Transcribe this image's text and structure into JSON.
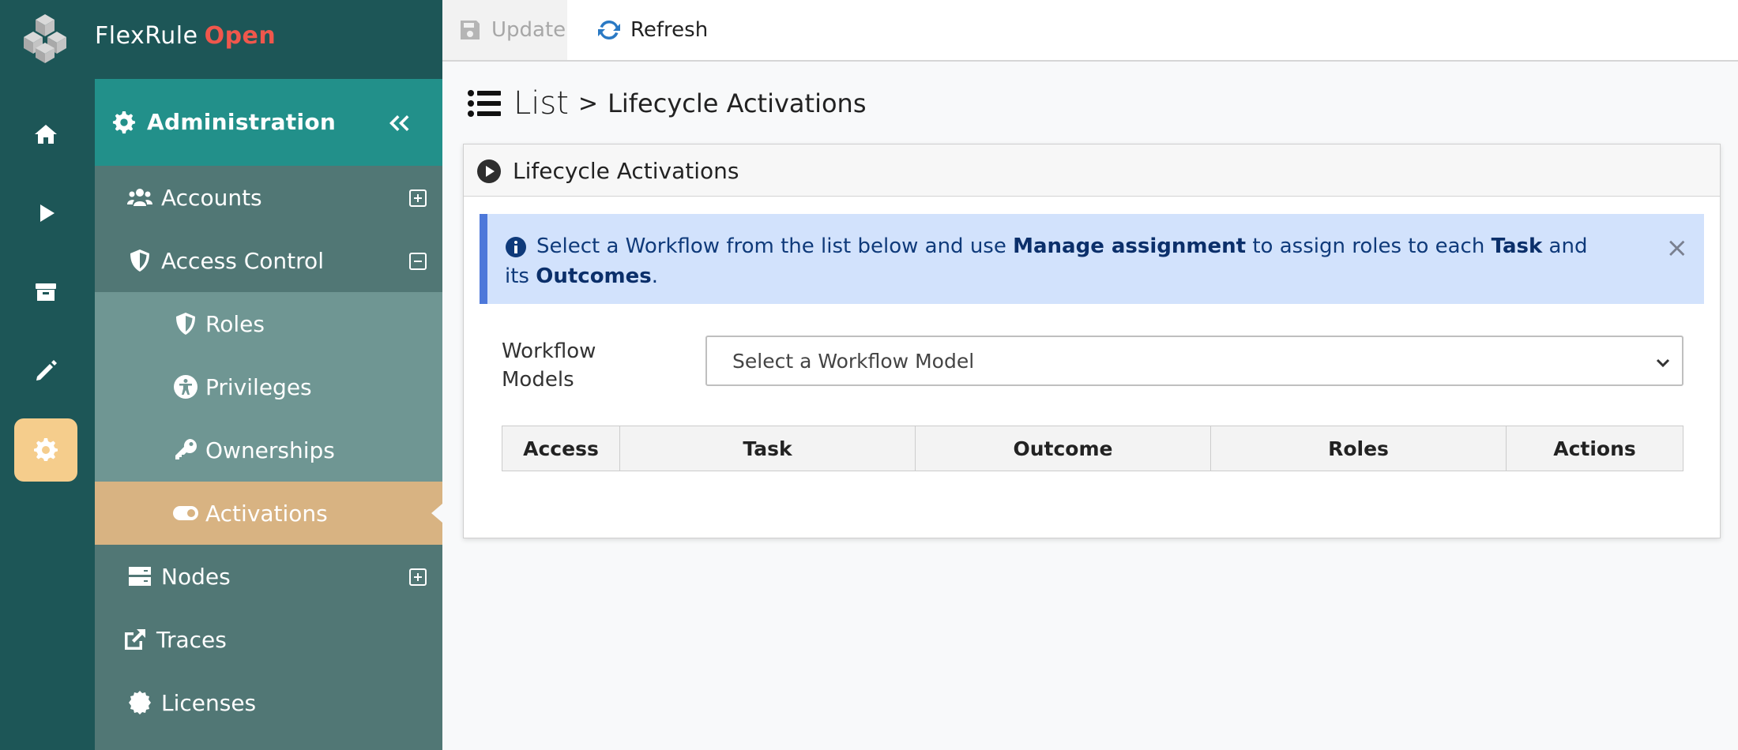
{
  "app": {
    "brand": "FlexRule",
    "brand_accent": "Open"
  },
  "rail": {
    "items": [
      {
        "icon": "home-icon"
      },
      {
        "icon": "play-icon"
      },
      {
        "icon": "archive-icon"
      },
      {
        "icon": "pencil-icon"
      },
      {
        "icon": "gear-icon",
        "active": true
      }
    ]
  },
  "sidebar": {
    "title": "Administration",
    "items": [
      {
        "label": "Accounts",
        "icon": "users-icon",
        "toggle": "expand"
      },
      {
        "label": "Access Control",
        "icon": "shield-icon",
        "toggle": "collapse"
      },
      {
        "label": "Roles",
        "icon": "shield-icon"
      },
      {
        "label": "Privileges",
        "icon": "person-icon"
      },
      {
        "label": "Ownerships",
        "icon": "key-icon"
      },
      {
        "label": "Activations",
        "icon": "toggle-icon",
        "active": true
      },
      {
        "label": "Nodes",
        "icon": "server-icon",
        "toggle": "expand"
      },
      {
        "label": "Traces",
        "icon": "external-link-icon"
      },
      {
        "label": "Licenses",
        "icon": "certificate-icon"
      }
    ]
  },
  "toolbar": {
    "update_label": "Update",
    "refresh_label": "Refresh"
  },
  "heading": {
    "list": "List",
    "separator": ">",
    "title": "Lifecycle Activations"
  },
  "card": {
    "title": "Lifecycle Activations",
    "alert": {
      "part1": "Select a Workflow from the list below and use ",
      "bold1": "Manage assignment",
      "part2": " to assign roles to each ",
      "bold2": "Task",
      "part3": " and its ",
      "bold3": "Outcomes",
      "part4": ".",
      "close": "×"
    },
    "workflow_label": "Workflow Models",
    "workflow_placeholder": "Select a Workflow Model",
    "columns": [
      "Access",
      "Task",
      "Outcome",
      "Roles",
      "Actions"
    ]
  },
  "colors": {
    "rail_bg": "#1d5657",
    "sidebar_bg": "#517775",
    "sidebar_head": "#22908a",
    "submenu_bg": "#6f9693",
    "active_item": "#d8b382",
    "brand_accent": "#f0574c",
    "alert_bg": "#d2e2fc"
  }
}
